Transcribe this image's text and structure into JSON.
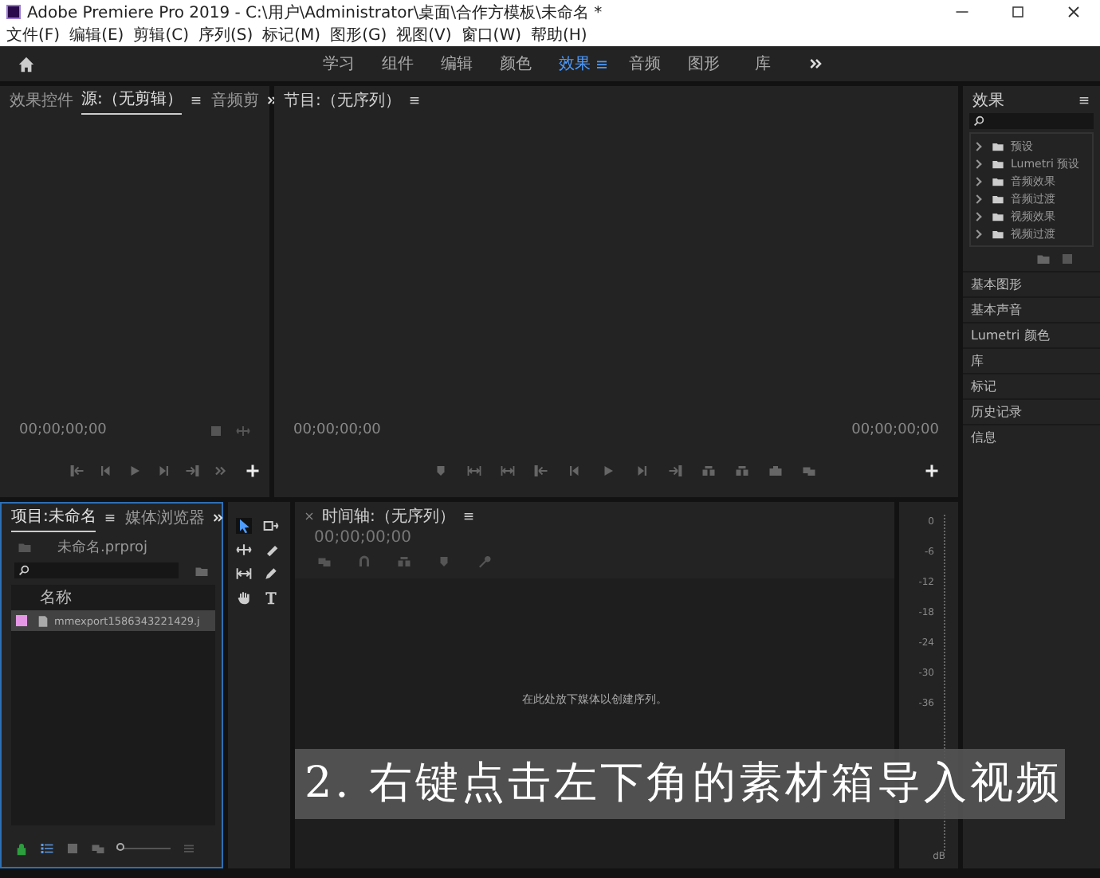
{
  "window": {
    "title": "Adobe Premiere Pro 2019 - C:\\用户\\Administrator\\桌面\\合作方模板\\未命名 *"
  },
  "menu": [
    "文件(F)",
    "编辑(E)",
    "剪辑(C)",
    "序列(S)",
    "标记(M)",
    "图形(G)",
    "视图(V)",
    "窗口(W)",
    "帮助(H)"
  ],
  "workspaces": [
    {
      "label": "学习",
      "selected": false
    },
    {
      "label": "组件",
      "selected": false
    },
    {
      "label": "编辑",
      "selected": false
    },
    {
      "label": "颜色",
      "selected": false
    },
    {
      "label": "效果",
      "selected": true
    },
    {
      "label": "音频",
      "selected": false
    },
    {
      "label": "图形",
      "selected": false
    },
    {
      "label": "库",
      "selected": false
    }
  ],
  "source_panel": {
    "tabs": [
      {
        "label": "效果控件",
        "selected": false
      },
      {
        "label": "源:（无剪辑）",
        "selected": true
      },
      {
        "label": "音频剪",
        "selected": false
      }
    ],
    "timecode": "00;00;00;00"
  },
  "program_panel": {
    "title": "节目:（无序列）",
    "timecode_left": "00;00;00;00",
    "timecode_right": "00;00;00;00"
  },
  "project_panel": {
    "tabs": [
      {
        "label": "项目:未命名",
        "selected": true
      },
      {
        "label": "媒体浏览器",
        "selected": false
      }
    ],
    "file": "未命名.prproj",
    "column": "名称",
    "items": [
      {
        "name": "mmexport1586343221429.j",
        "color": "#e597e6",
        "selected": true
      }
    ],
    "zoom_slider": {
      "level": 0
    }
  },
  "timeline": {
    "title": "时间轴:（无序列）",
    "timecode": "00;00;00;00",
    "hint": "在此处放下媒体以创建序列。"
  },
  "meter": {
    "ticks": [
      "0",
      "-6",
      "-12",
      "-18",
      "-24",
      "-30",
      "-36"
    ],
    "unit": "dB"
  },
  "effects_panel": {
    "title": "效果",
    "folders": [
      "预设",
      "Lumetri 预设",
      "音频效果",
      "音频过渡",
      "视频效果",
      "视频过渡"
    ],
    "panels": [
      "基本图形",
      "基本声音",
      "Lumetri 颜色",
      "库",
      "标记",
      "历史记录",
      "信息"
    ]
  },
  "caption": "2. 右键点击左下角的素材箱导入视频"
}
